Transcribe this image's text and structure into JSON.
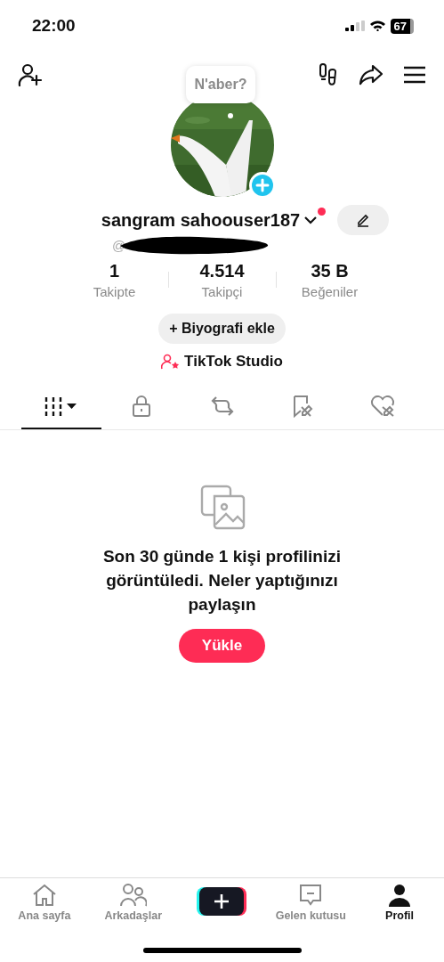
{
  "status_bar": {
    "time": "22:00",
    "battery": "67"
  },
  "profile": {
    "bubble": "N'aber?",
    "name": "sangram sahoouser187",
    "has_notification": true,
    "handle": "@",
    "stats": [
      {
        "value": "1",
        "label": "Takipte"
      },
      {
        "value": "4.514",
        "label": "Takipçi"
      },
      {
        "value": "35 B",
        "label": "Beğeniler"
      }
    ],
    "bio_button": "+ Biyografi ekle",
    "studio": "TikTok Studio"
  },
  "tabs": [
    {
      "kind": "grid",
      "selected": true
    },
    {
      "kind": "lock",
      "selected": false
    },
    {
      "kind": "repost",
      "selected": false
    },
    {
      "kind": "bookmark",
      "selected": false
    },
    {
      "kind": "heart",
      "selected": false
    }
  ],
  "empty_state": {
    "message": "Son 30 günde 1 kişi profilinizi görüntüledi. Neler yaptığınızı paylaşın",
    "button": "Yükle"
  },
  "bottom_nav": [
    {
      "kind": "home",
      "label": "Ana sayfa",
      "selected": false
    },
    {
      "kind": "friends",
      "label": "Arkadaşlar",
      "selected": false
    },
    {
      "kind": "create",
      "selected": false
    },
    {
      "kind": "inbox",
      "label": "Gelen kutusu",
      "selected": false
    },
    {
      "kind": "profile",
      "label": "Profil",
      "selected": true
    }
  ]
}
